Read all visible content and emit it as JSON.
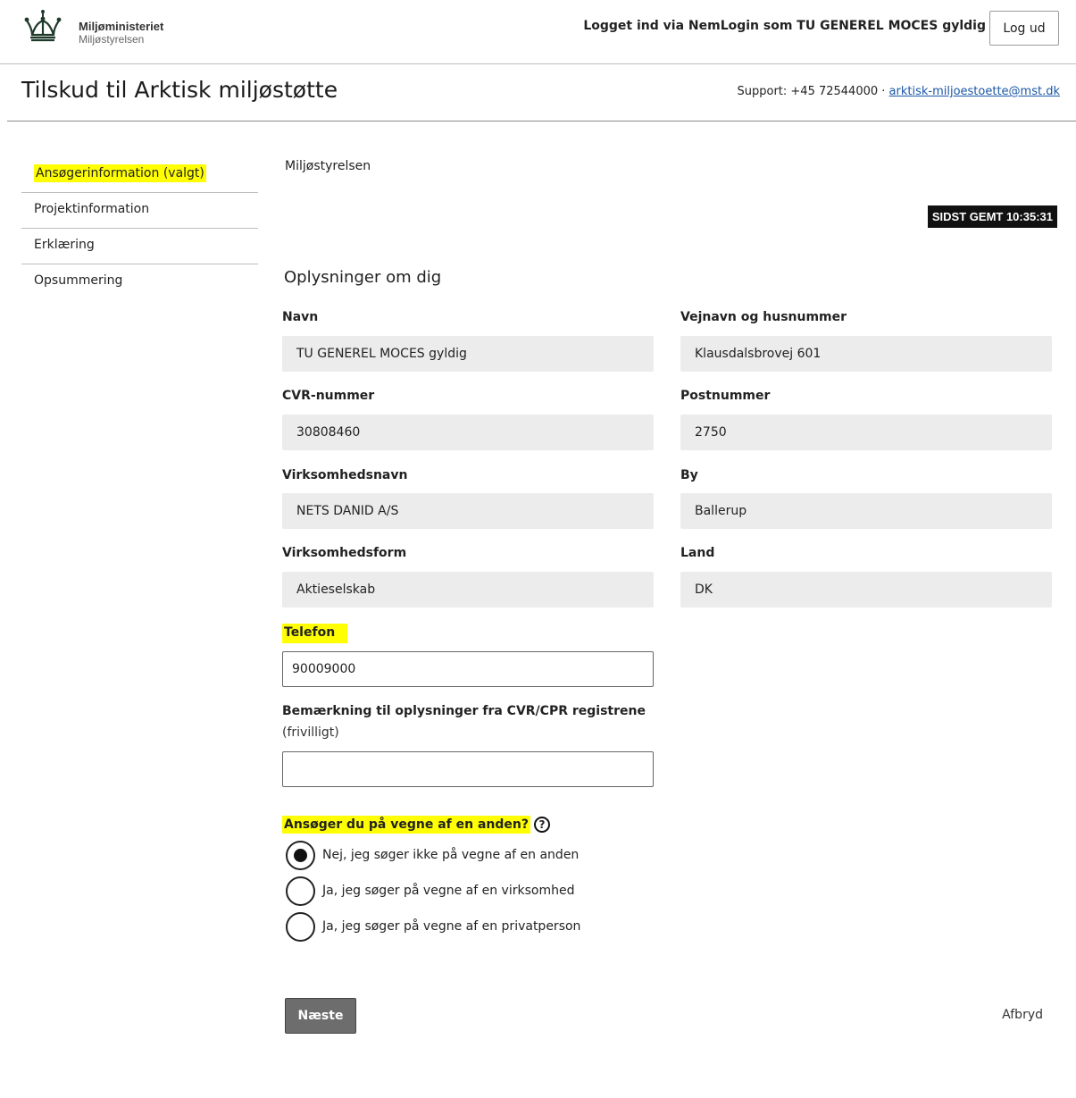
{
  "header": {
    "logo_icon": "crown-icon",
    "logo_main": "Miljøministeriet",
    "logo_sub": "Miljøstyrelsen",
    "login_status": "Logget ind via NemLogin som TU GENEREL MOCES gyldig",
    "logout_label": "Log ud"
  },
  "titlebar": {
    "title": "Tilskud til Arktisk miljøstøtte",
    "support_prefix": "Support: +45 72544000 · ",
    "support_email": "arktisk-miljoestoette@mst.dk"
  },
  "sidebar": {
    "items": [
      {
        "label": "Ansøgerinformation (valgt)",
        "selected": true
      },
      {
        "label": "Projektinformation",
        "selected": false
      },
      {
        "label": "Erklæring",
        "selected": false
      },
      {
        "label": "Opsummering",
        "selected": false
      }
    ]
  },
  "main": {
    "org_name": "Miljøstyrelsen",
    "saved_badge": "SIDST GEMT 10:35:31",
    "section_title": "Oplysninger om dig",
    "fields": {
      "navn": {
        "label": "Navn",
        "value": "TU GENEREL MOCES gyldig"
      },
      "vejnavn": {
        "label": "Vejnavn og husnummer",
        "value": "Klausdalsbrovej 601"
      },
      "cvr": {
        "label": "CVR-nummer",
        "value": "30808460"
      },
      "postnummer": {
        "label": "Postnummer",
        "value": "2750"
      },
      "virksomhedsnavn": {
        "label": "Virksomhedsnavn",
        "value": "NETS DANID A/S"
      },
      "by": {
        "label": "By",
        "value": "Ballerup"
      },
      "virksomhedsform": {
        "label": "Virksomhedsform",
        "value": "Aktieselskab"
      },
      "land": {
        "label": "Land",
        "value": "DK"
      }
    },
    "telefon": {
      "label": "Telefon",
      "value": "90009000"
    },
    "bemaerkning": {
      "label": "Bemærkning til oplysninger fra CVR/CPR registrene",
      "optional": "(frivilligt)",
      "value": ""
    },
    "question": {
      "label": "Ansøger du på vegne af en anden?",
      "help_icon": "question-circle-icon",
      "options": [
        {
          "label": "Nej, jeg søger ikke på vegne af en anden",
          "checked": true
        },
        {
          "label": "Ja, jeg søger på vegne af en virksomhed",
          "checked": false
        },
        {
          "label": "Ja, jeg søger på vegne af en privatperson",
          "checked": false
        }
      ]
    },
    "next_label": "Næste",
    "cancel_label": "Afbryd"
  }
}
